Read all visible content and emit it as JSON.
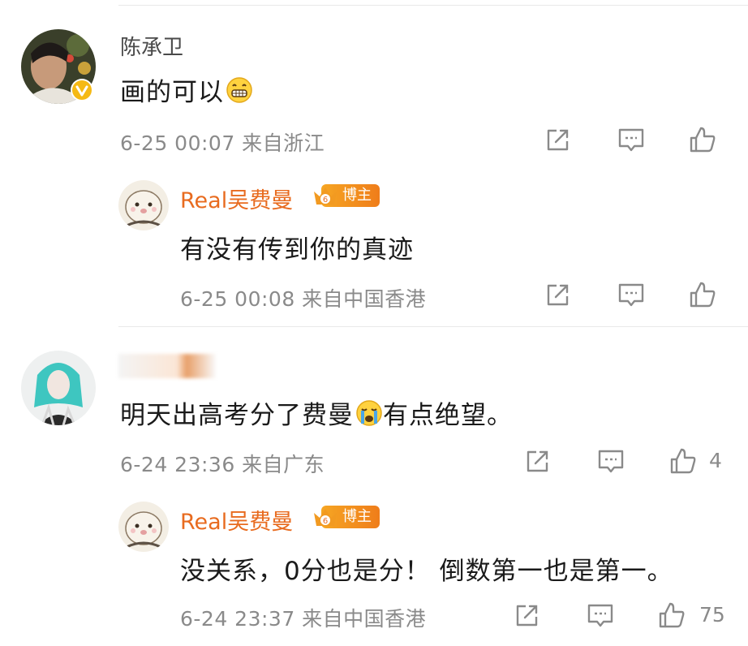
{
  "colors": {
    "blogger_name": "#e86b1f",
    "meta": "#8a8a8a",
    "badge": "#f29a21"
  },
  "comments": [
    {
      "user": "陈承卫",
      "verified": true,
      "text": "画的可以",
      "emoji": "grin-emoji",
      "meta": "6-25 00:07 来自浙江",
      "likes": "",
      "reply": {
        "user": "Real吴费曼",
        "badge": "博主",
        "badge_level": "6",
        "text": "有没有传到你的真迹",
        "meta": "6-25 00:08 来自中国香港",
        "likes": ""
      }
    },
    {
      "user": "",
      "verified": false,
      "text_before": "明天出高考分了费曼",
      "emoji": "crying-emoji",
      "text_after": "有点绝望。",
      "meta": "6-24 23:36 来自广东",
      "likes": "4",
      "reply": {
        "user": "Real吴费曼",
        "badge": "博主",
        "badge_level": "6",
        "text": "没关系，0分也是分！ 倒数第一也是第一。",
        "meta": "6-24 23:37 来自中国香港",
        "likes": "75"
      }
    }
  ]
}
